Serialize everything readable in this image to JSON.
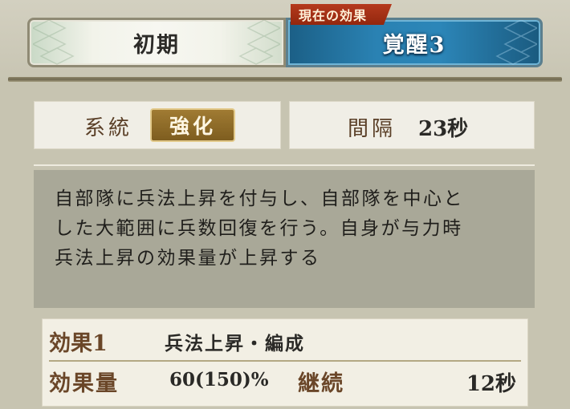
{
  "tabs": {
    "initial_label": "初期",
    "awaken_label": "覚醒3",
    "current_effect_label": "現在の効果"
  },
  "system": {
    "label": "系統",
    "value": "強化"
  },
  "interval": {
    "label": "間隔",
    "value": "23秒"
  },
  "description": {
    "line1": "自部隊に兵法上昇を付与し、自部隊を中心と",
    "line2": "した大範囲に兵数回復を行う。自身が与力時",
    "line3": "兵法上昇の効果量が上昇する"
  },
  "effect": {
    "name_label": "効果1",
    "name_value": "兵法上昇・編成",
    "amount_label": "効果量",
    "amount_value": "60(150)%",
    "duration_label": "継続",
    "duration_value": "12秒"
  },
  "colors": {
    "awaken_tab": "#2a82b3",
    "current_label_bg": "#b53a1d",
    "badge_bg": "#8c6a28"
  },
  "icons": {
    "tab_ornament": "lattice-pattern-icon"
  }
}
